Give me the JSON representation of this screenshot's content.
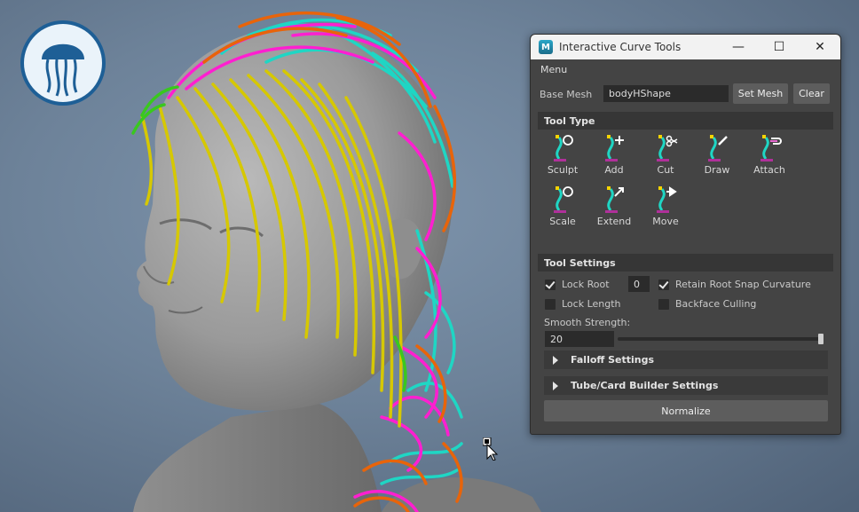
{
  "window": {
    "title": "Interactive Curve Tools",
    "app_icon_letter": "M",
    "controls": {
      "minimize": "—",
      "maximize": "☐",
      "close": "✕"
    }
  },
  "menu": {
    "label": "Menu"
  },
  "base_mesh": {
    "label": "Base Mesh",
    "value": "bodyHShape",
    "set_button": "Set Mesh",
    "clear_button": "Clear"
  },
  "tool_type": {
    "header": "Tool Type",
    "tools": [
      {
        "label": "Sculpt",
        "icon": "sculpt-icon"
      },
      {
        "label": "Add",
        "icon": "add-icon"
      },
      {
        "label": "Cut",
        "icon": "cut-icon"
      },
      {
        "label": "Draw",
        "icon": "draw-icon"
      },
      {
        "label": "Attach",
        "icon": "attach-icon"
      },
      {
        "label": "Scale",
        "icon": "scale-icon"
      },
      {
        "label": "Extend",
        "icon": "extend-icon"
      },
      {
        "label": "Move",
        "icon": "move-icon"
      }
    ]
  },
  "tool_settings": {
    "header": "Tool Settings",
    "lock_root": {
      "label": "Lock Root",
      "checked": true,
      "value": "0"
    },
    "retain_root": {
      "label": "Retain Root Snap Curvature",
      "checked": true
    },
    "lock_length": {
      "label": "Lock Length",
      "checked": false
    },
    "backface": {
      "label": "Backface Culling",
      "checked": false
    },
    "smooth_strength": {
      "label": "Smooth Strength:",
      "value": "20",
      "fraction": 1.0
    },
    "falloff": "Falloff Settings",
    "tube_card": "Tube/Card Builder Settings",
    "normalize": "Normalize"
  },
  "colors": {
    "panel_bg": "#444444",
    "field_bg": "#2b2b2b",
    "hair_yellow": "#d6c800",
    "hair_magenta": "#ff1fd0",
    "hair_cyan": "#1fd6c4",
    "hair_orange": "#e8640a",
    "hair_green": "#39c81e"
  }
}
